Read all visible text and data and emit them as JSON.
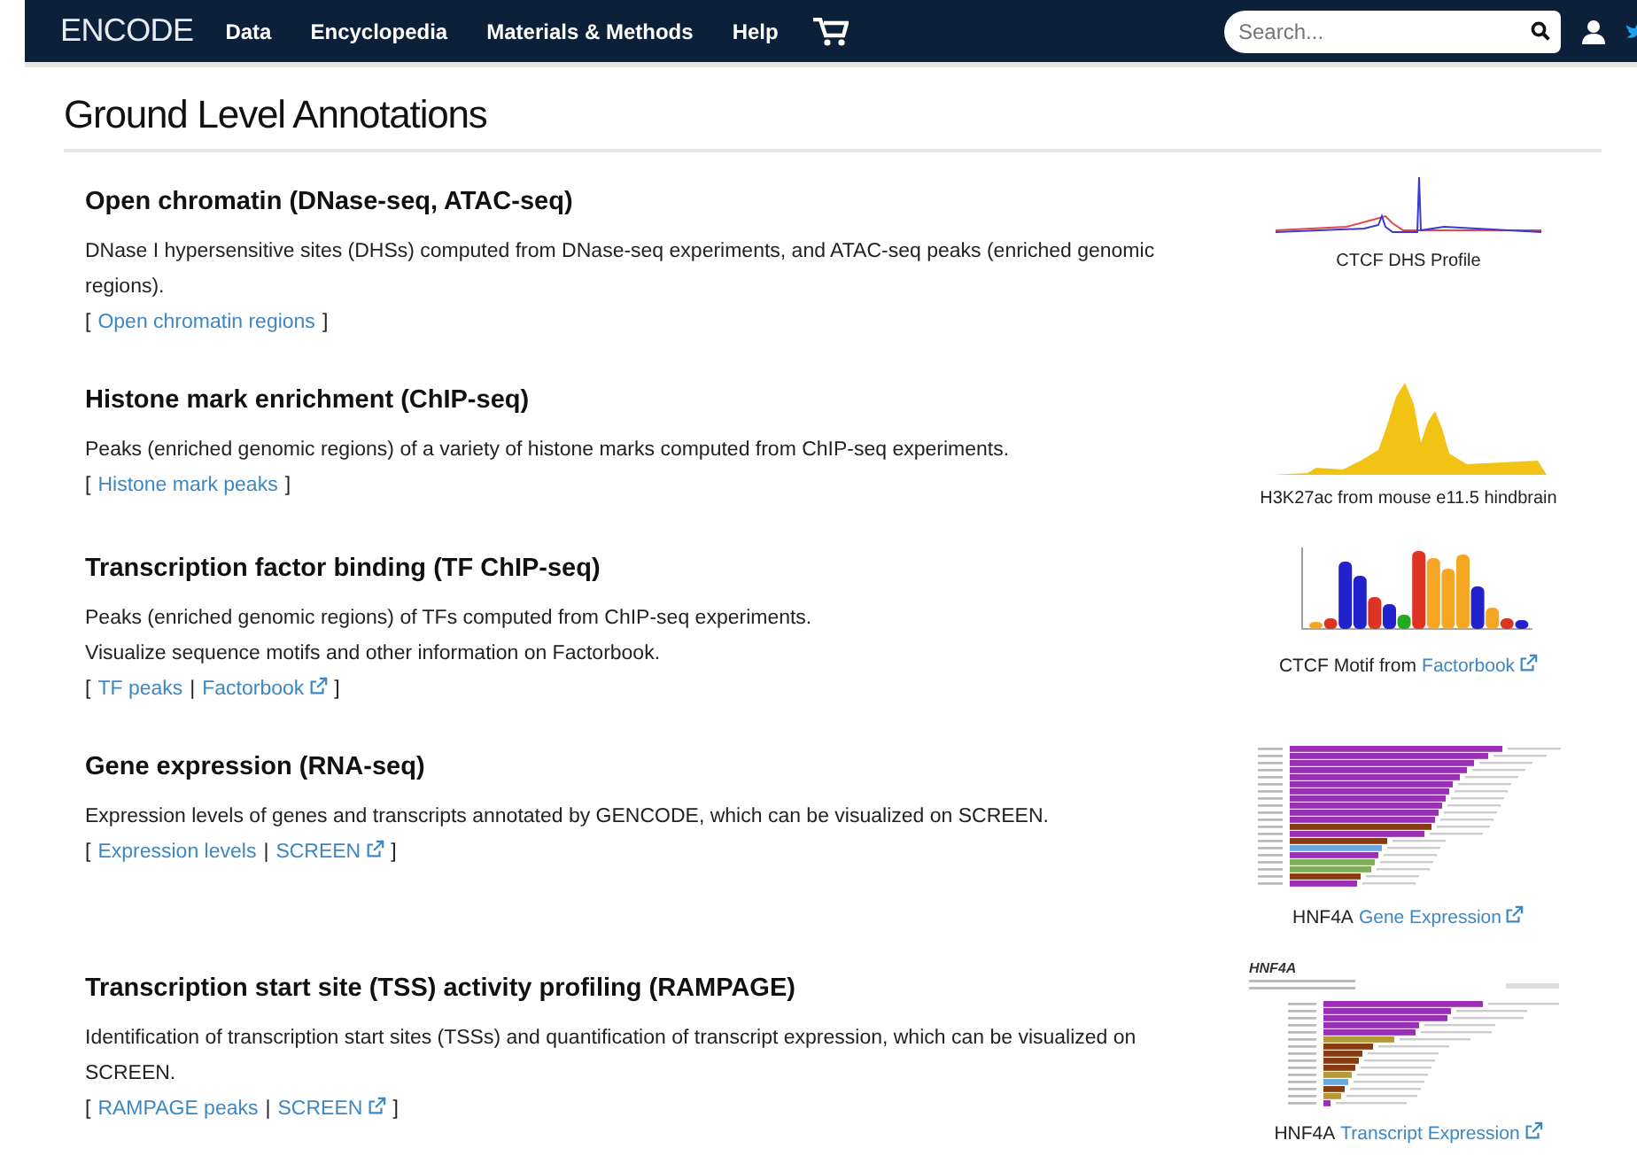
{
  "nav": {
    "brand": "ENCODE",
    "items": [
      "Data",
      "Encyclopedia",
      "Materials & Methods",
      "Help"
    ],
    "search": {
      "placeholder": "Search..."
    }
  },
  "page": {
    "title": "Ground Level Annotations"
  },
  "sections": [
    {
      "title": "Open chromatin (DNase-seq, ATAC-seq)",
      "description": [
        "DNase I hypersensitive sites (DHSs) computed from DNase-seq experiments, and ATAC-seq peaks (enriched genomic regions)."
      ],
      "links": [
        {
          "kind": "mark",
          "text": "["
        },
        {
          "kind": "link",
          "text": "Open chromatin regions",
          "external": false
        },
        {
          "kind": "mark",
          "text": "]"
        }
      ],
      "figure": {
        "kind": "profile",
        "caption": [
          {
            "kind": "text",
            "text": "CTCF DHS Profile"
          }
        ]
      }
    },
    {
      "title": "Histone mark enrichment (ChIP-seq)",
      "description": [
        "Peaks (enriched genomic regions) of a variety of histone marks computed from ChIP-seq experiments."
      ],
      "links": [
        {
          "kind": "mark",
          "text": "["
        },
        {
          "kind": "link",
          "text": "Histone mark peaks",
          "external": false
        },
        {
          "kind": "mark",
          "text": "]"
        }
      ],
      "figure": {
        "kind": "peaks",
        "caption": [
          {
            "kind": "text",
            "text": "H3K27ac from mouse e11.5 hindbrain"
          }
        ]
      }
    },
    {
      "title": "Transcription factor binding (TF ChIP-seq)",
      "description": [
        "Peaks (enriched genomic regions) of TFs computed from ChIP-seq experiments.",
        "Visualize sequence motifs and other information on Factorbook."
      ],
      "links": [
        {
          "kind": "mark",
          "text": "["
        },
        {
          "kind": "link",
          "text": "TF peaks",
          "external": false
        },
        {
          "kind": "mark",
          "text": "|"
        },
        {
          "kind": "link",
          "text": "Factorbook",
          "external": true
        },
        {
          "kind": "mark",
          "text": "]"
        }
      ],
      "figure": {
        "kind": "motif",
        "caption": [
          {
            "kind": "text",
            "text": "CTCF Motif from"
          },
          {
            "kind": "link",
            "text": "Factorbook",
            "external": true
          }
        ]
      }
    },
    {
      "title": "Gene expression (RNA-seq)",
      "description": [
        "Expression levels of genes and transcripts annotated by GENCODE, which can be visualized on SCREEN."
      ],
      "links": [
        {
          "kind": "mark",
          "text": "["
        },
        {
          "kind": "link",
          "text": "Expression levels",
          "external": false
        },
        {
          "kind": "mark",
          "text": "|"
        },
        {
          "kind": "link",
          "text": "SCREEN",
          "external": true
        },
        {
          "kind": "mark",
          "text": "]"
        }
      ],
      "figure": {
        "kind": "gene-bars",
        "caption": [
          {
            "kind": "text",
            "text": "HNF4A"
          },
          {
            "kind": "link",
            "text": "Gene Expression",
            "external": true
          }
        ]
      }
    },
    {
      "title": "Transcription start site (TSS) activity profiling (RAMPAGE)",
      "description": [
        "Identification of transcription start sites (TSSs) and quantification of transcript expression, which can be visualized on SCREEN."
      ],
      "links": [
        {
          "kind": "mark",
          "text": "["
        },
        {
          "kind": "link",
          "text": "RAMPAGE peaks",
          "external": false
        },
        {
          "kind": "mark",
          "text": "|"
        },
        {
          "kind": "link",
          "text": "SCREEN",
          "external": true
        },
        {
          "kind": "mark",
          "text": "]"
        }
      ],
      "figure": {
        "kind": "transcript-bars",
        "title": "HNF4A",
        "caption": [
          {
            "kind": "text",
            "text": "HNF4A"
          },
          {
            "kind": "link",
            "text": "Transcript Expression",
            "external": true
          }
        ]
      }
    }
  ]
}
